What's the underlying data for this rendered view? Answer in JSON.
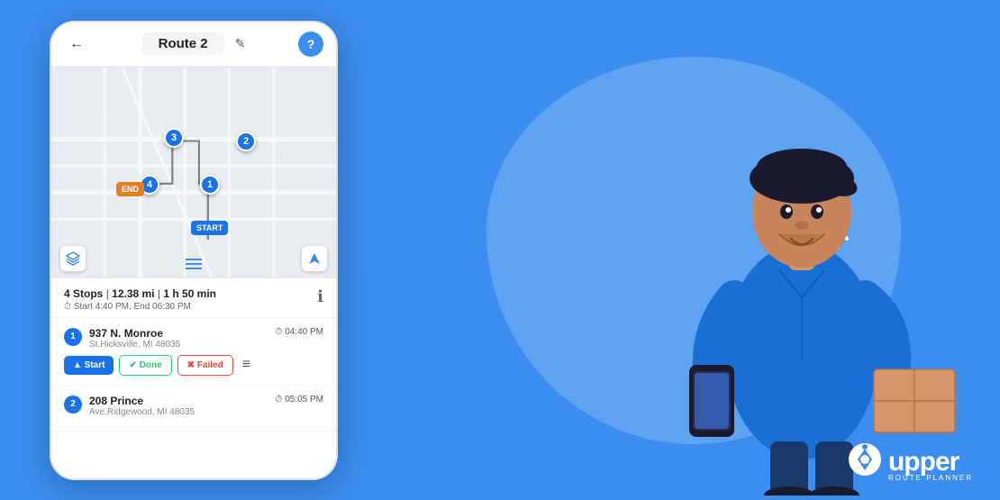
{
  "app": {
    "background_color": "#3b8ef0"
  },
  "phone": {
    "header": {
      "back_label": "←",
      "route_title": "Route 2",
      "edit_icon": "✎",
      "help_label": "?"
    },
    "summary": {
      "stops_count": "4 Stops",
      "distance": "12.38 mi",
      "duration": "1 h 50 min",
      "time_range": "Start 4:40 PM, End 06:30 PM"
    },
    "stops": [
      {
        "number": "1",
        "street": "937 N. Monroe",
        "city": "St.Hicksville, MI 48035",
        "time": "04:40 PM",
        "actions": [
          "Start",
          "Done",
          "Failed"
        ]
      },
      {
        "number": "2",
        "street": "208 Prince",
        "city": "Ave.Ridgewood, MI 48035",
        "time": "05:05 PM"
      }
    ],
    "map": {
      "start_label": "START",
      "end_label": "END",
      "stops": [
        "1",
        "2",
        "3",
        "4"
      ]
    }
  },
  "buttons": {
    "start_label": "▲ Start",
    "done_label": "✔ Done",
    "failed_label": "✖ Failed"
  },
  "logo": {
    "brand": "upper",
    "tagline": "Route Planner"
  }
}
